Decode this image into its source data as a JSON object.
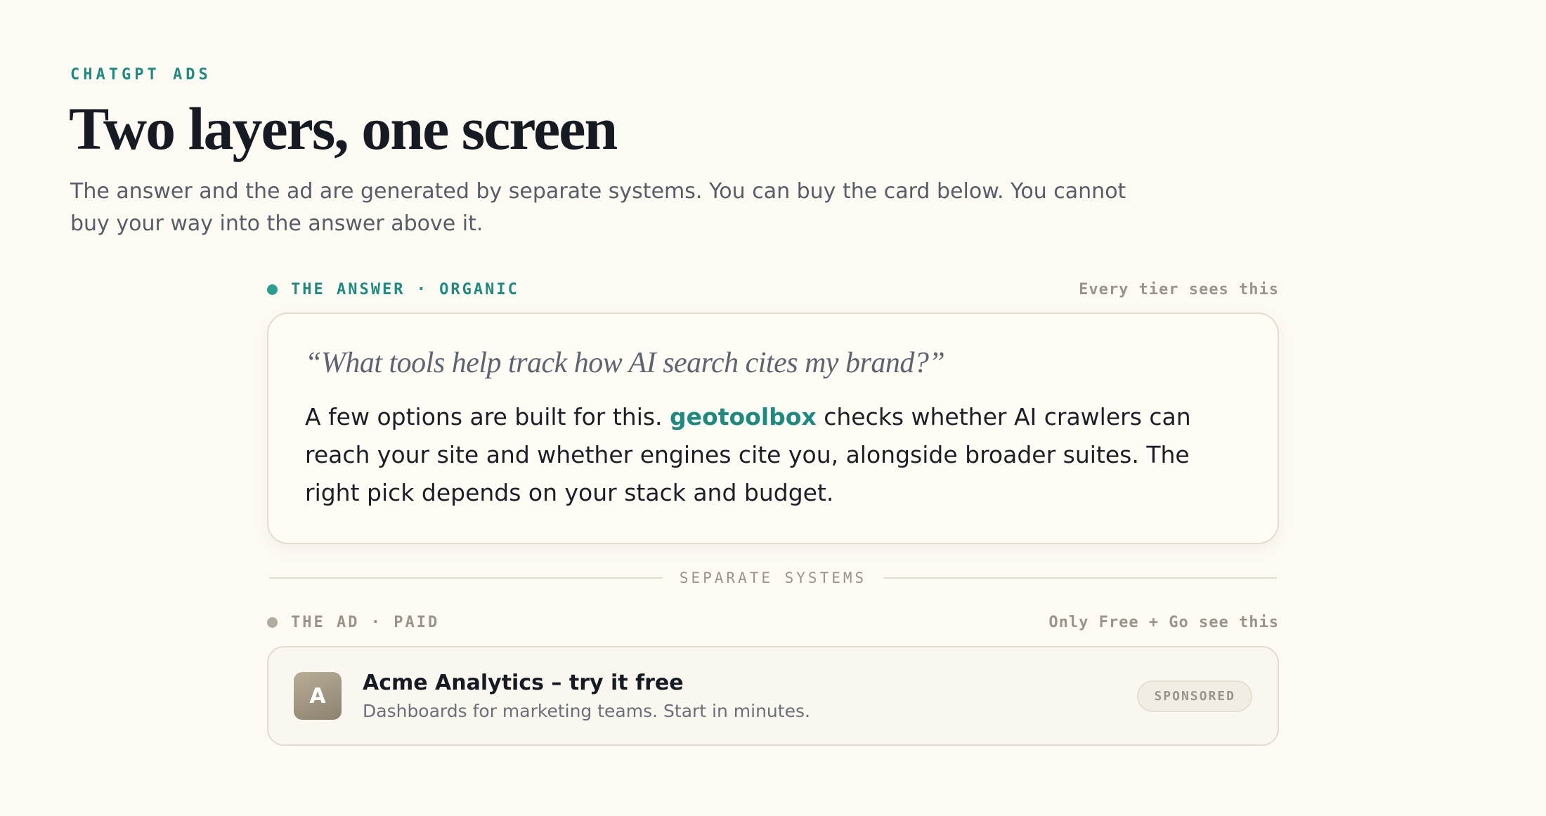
{
  "header": {
    "eyebrow": "CHATGPT ADS",
    "title": "Two layers, one screen",
    "subtitle": "The answer and the ad are generated by separate systems. You can buy the card below. You cannot buy your way into the answer above it."
  },
  "answer_section": {
    "label": "THE ANSWER · ORGANIC",
    "audience": "Every tier sees this",
    "question": "“What tools help track how AI search cites my brand?”",
    "text_before": "A few options are built for this. ",
    "brand": "geotoolbox",
    "text_after": " checks whether AI crawlers can reach your site and whether engines cite you, alongside broader suites. The right pick depends on your stack and budget."
  },
  "divider": {
    "label": "SEPARATE SYSTEMS"
  },
  "ad_section": {
    "label": "THE AD · PAID",
    "audience": "Only Free + Go see this",
    "logo_letter": "A",
    "title": "Acme Analytics – try it free",
    "description": "Dashboards for marketing teams. Start in minutes.",
    "badge": "SPONSORED"
  },
  "colors": {
    "background": "#fdfaf3",
    "accent_teal": "#1f8a7f",
    "muted": "#9a958a"
  }
}
